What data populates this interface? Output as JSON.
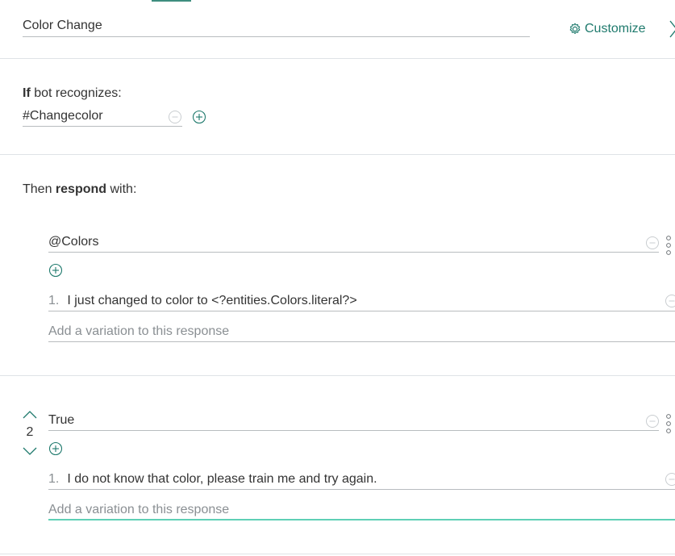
{
  "header": {
    "node_name": "Color Change",
    "customize_label": "Customize"
  },
  "if_section": {
    "label_bold": "If",
    "label_rest": " bot recognizes:",
    "condition": "#Changecolor"
  },
  "then_section": {
    "label_prefix": "Then ",
    "label_bold": "respond",
    "label_suffix": " with:"
  },
  "responses": [
    {
      "condition": "@Colors",
      "variations": [
        {
          "num": "1.",
          "text": "I just changed to color to <?entities.Colors.literal?>"
        }
      ],
      "add_variation_placeholder": "Add a variation to this response"
    },
    {
      "order": "2",
      "condition": "True",
      "variations": [
        {
          "num": "1.",
          "text": "I do not know that color, please train me and try again."
        }
      ],
      "add_variation_placeholder": "Add a variation to this response"
    }
  ],
  "colors": {
    "accent": "#1f7a6d",
    "active_underline": "#5fd0b6",
    "divider": "#dfe3e6"
  }
}
